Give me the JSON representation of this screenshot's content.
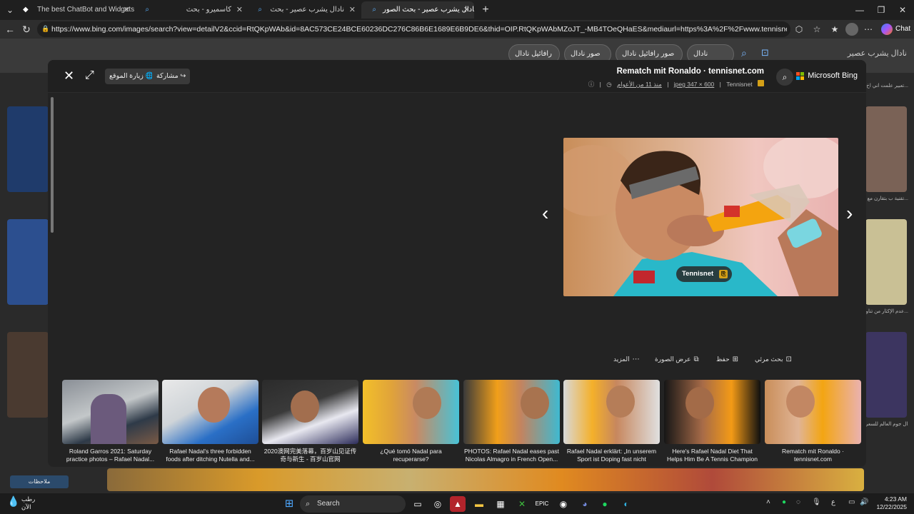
{
  "browser": {
    "tabs": [
      {
        "label": "The best ChatBot and Widgets for",
        "icon": "diamond-icon"
      },
      {
        "label": "كاسميرو - بحث",
        "icon": "search-icon"
      },
      {
        "label": "نادال يشرب عصير - بحث",
        "icon": "search-icon"
      },
      {
        "label": "نادال يشرب عصير - بحث الصور",
        "icon": "search-icon"
      }
    ],
    "new_tab": "+",
    "url": "https://www.bing.com/images/search?view=detailV2&ccid=RtQKpWAb&id=8AC573CE24BCE60236DC276C86B6E1689E6B9DE6&thid=OIP.RtQKpWAbMZoJT_-MB4TOeQHaES&mediaurl=https%3A%2F%2Fwww.tennisnet.com%2Ffileadmin%2F user_up...",
    "chat_label": "Chat"
  },
  "background": {
    "search_text": "نادال يشرب عصير",
    "pills": [
      "نادال",
      "صور رافائيل نادال",
      "صور نادال",
      "رافائيل نادال"
    ],
    "side_texts": [
      "تعبير علمت اني اخ...",
      "تقنية ب بتقارن مع...",
      "عدم الإكثار من تناو...",
      "حتزال رافائيل نادال جوم العالم للسعر..."
    ],
    "bottom_text": "ملاحظات"
  },
  "modal": {
    "share_label": "مشاركة",
    "visit_label": "زيارة الموقع",
    "title": "Rematch mit Ronaldo · tennisnet.com",
    "meta": {
      "source": "Tennisnet",
      "dims": "jpeg 347 × 600",
      "age": "منذ 11 من الأعوام"
    },
    "brand": "Microsoft Bing",
    "image_badge": "Tennisnet",
    "actions": {
      "visual_search": "بحث مرئي",
      "save": "حفظ",
      "view_image": "عرض الصورة",
      "more": "المزيد"
    }
  },
  "thumbnails": [
    {
      "caption": "Roland Garros 2021: Saturday practice photos – Rafael Nadal..."
    },
    {
      "caption": "Rafael Nadal's three forbidden foods after ditching Nutella and..."
    },
    {
      "caption": "2020澳网完美落幕，百岁山见证传奇与新生 - 百岁山官网"
    },
    {
      "caption": "¿Qué tomó Nadal para recuperarse?"
    },
    {
      "caption": "PHOTOS: Rafael Nadal eases past Nicolas Almagro in French Open..."
    },
    {
      "caption": "Rafael Nadal erklärt: „In unserem Sport ist Doping fast nicht möglich..."
    },
    {
      "caption": "Here's Rafael Nadal Diet That Helps Him Be A Tennis Champion -..."
    },
    {
      "caption": "Rematch mit Ronaldo · tennisnet.com"
    }
  ],
  "taskbar": {
    "weather_temp": "رطب",
    "weather_sub": "الآن",
    "search_label": "Search",
    "time": "4:23 AM",
    "date": "12/22/2025",
    "lang": "ع"
  }
}
